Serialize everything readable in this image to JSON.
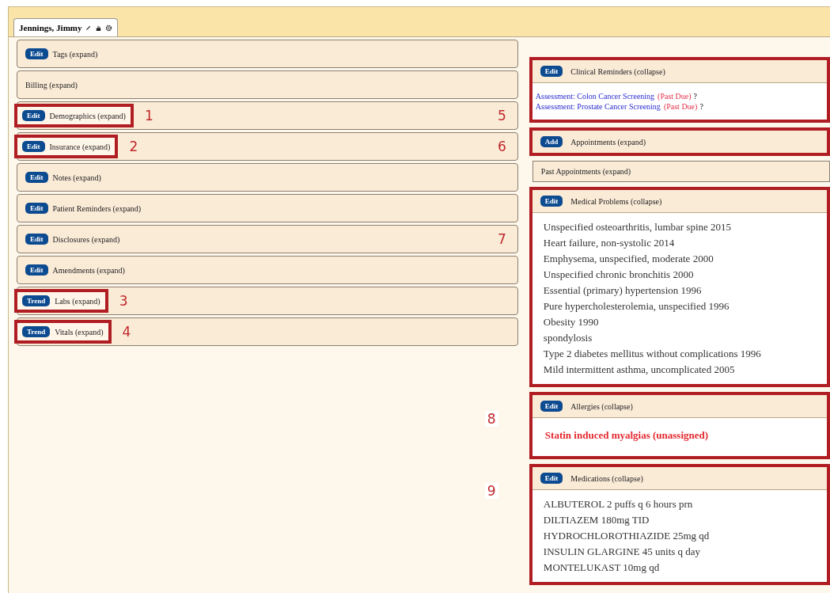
{
  "tab": {
    "title": "Jennings, Jimmy",
    "selected": true
  },
  "left_sections": [
    {
      "button": "Edit",
      "title": "Tags (expand)",
      "highlighted": false
    },
    {
      "title": "Billing (expand)",
      "highlighted": false
    },
    {
      "button": "Edit",
      "title": "Demographics (expand)",
      "highlighted": true,
      "marker": "1",
      "end_marker": "5"
    },
    {
      "button": "Edit",
      "title": "Insurance (expand)",
      "highlighted": true,
      "marker": "2",
      "end_marker": "6"
    },
    {
      "button": "Edit",
      "title": "Notes (expand)",
      "highlighted": false
    },
    {
      "button": "Edit",
      "title": "Patient Reminders (expand)",
      "highlighted": false
    },
    {
      "button": "Edit",
      "title": "Disclosures (expand)",
      "highlighted": false,
      "end_marker": "7"
    },
    {
      "button": "Edit",
      "title": "Amendments (expand)",
      "highlighted": false
    },
    {
      "button": "Trend",
      "title": "Labs (expand)",
      "highlighted": true,
      "marker": "3"
    },
    {
      "button": "Trend",
      "title": "Vitals (expand)",
      "highlighted": true,
      "marker": "4"
    }
  ],
  "right_sections": [
    {
      "kind": "reminders",
      "button": "Edit",
      "title": "Clinical Reminders (collapse)",
      "highlighted": true,
      "items": [
        {
          "text": "Assessment: Colon Cancer Screening",
          "status": "(Past Due)",
          "suffix": "?"
        },
        {
          "text": "Assessment: Prostate Cancer Screening",
          "status": "(Past Due)",
          "suffix": "?"
        }
      ]
    },
    {
      "kind": "header",
      "button": "Add",
      "title": "Appointments (expand)",
      "highlighted": true
    },
    {
      "kind": "header",
      "title": "Past Appointments (expand)",
      "highlighted": false
    },
    {
      "kind": "list",
      "button": "Edit",
      "title": "Medical Problems (collapse)",
      "highlighted": true,
      "items": [
        "Unspecified osteoarthritis, lumbar spine 2015",
        "Heart failure, non-systolic 2014",
        "Emphysema, unspecified, moderate 2000",
        "Unspecified chronic bronchitis 2000",
        "Essential (primary) hypertension 1996",
        "Pure hypercholesterolemia, unspecified 1996",
        "Obesity 1990",
        "spondylosis",
        "Type 2 diabetes mellitus without complications 1996",
        "Mild intermittent asthma, uncomplicated 2005"
      ]
    },
    {
      "kind": "alerts",
      "button": "Edit",
      "title": "Allergies (collapse)",
      "highlighted": true,
      "marker": "8",
      "items": [
        "Statin induced myalgias (unassigned)"
      ]
    },
    {
      "kind": "list",
      "button": "Edit",
      "title": "Medications (collapse)",
      "highlighted": true,
      "marker": "9",
      "items": [
        "ALBUTEROL 2 puffs q 6 hours prn",
        "DILTIAZEM 180mg TID",
        "HYDROCHLOROTHIAZIDE 25mg qd",
        "INSULIN GLARGINE 45 units q day",
        "MONTELUKAST 10mg qd"
      ]
    }
  ]
}
